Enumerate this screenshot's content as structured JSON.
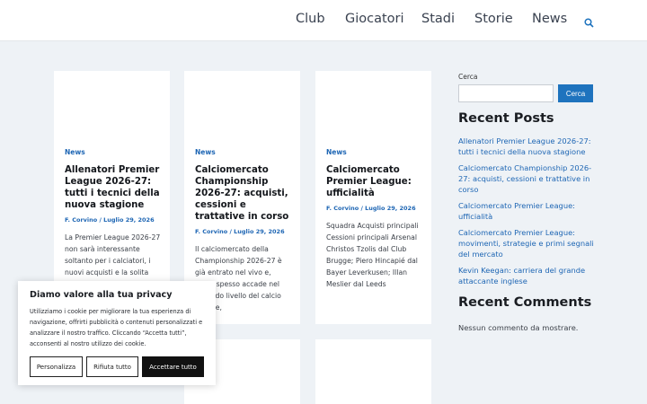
{
  "nav": {
    "items": [
      "Club",
      "Giocatori",
      "Stadi",
      "Storie",
      "News"
    ],
    "search_icon": "search-icon"
  },
  "posts": [
    {
      "category": "News",
      "title": "Allenatori Premier League 2026-27: tutti i tecnici della nuova stagione",
      "meta": "F. Corvino / Luglio 29, 2026",
      "excerpt": "La Premier League 2026-27 non sarà interessante soltanto per i calciatori, i nuovi acquisti e la solita"
    },
    {
      "category": "News",
      "title": "Calciomercato Championship 2026-27: acquisti, cessioni e trattative in corso",
      "meta": "F. Corvino / Luglio 29, 2026",
      "excerpt": "Il calciomercato della Championship 2026-27 è già entrato nel vivo e, come spesso accade nel secondo livello del calcio inglese,"
    },
    {
      "category": "News",
      "title": "Calciomercato Premier League: ufficialità",
      "meta": "F. Corvino / Luglio 29, 2026",
      "excerpt": "Squadra Acquisti principali Cessioni principali Arsenal Christos Tzolis dal Club Brugge; Piero Hincapié dal Bayer Leverkusen; Illan Meslier dal Leeds"
    }
  ],
  "sidebar": {
    "search_label": "Cerca",
    "search_button": "Cerca",
    "search_value": "",
    "recent_posts_heading": "Recent Posts",
    "recent_posts": [
      "Allenatori Premier League 2026-27: tutti i tecnici della nuova stagione",
      "Calciomercato Championship 2026-27: acquisti, cessioni e trattative in corso",
      "Calciomercato Premier League: ufficialità",
      "Calciomercato Premier League: movimenti, strategie e primi segnali del mercato",
      "Kevin Keegan: carriera del grande attaccante inglese"
    ],
    "recent_comments_heading": "Recent Comments",
    "no_comments": "Nessun commento da mostrare."
  },
  "cookie": {
    "title": "Diamo valore alla tua privacy",
    "text": "Utilizziamo i cookie per migliorare la tua esperienza di navigazione, offrirti pubblicità o contenuti personalizzati e analizzare il nostro traffico. Cliccando “Accetta tutti”, acconsenti al nostro utilizzo dei cookie.",
    "customize": "Personalizza",
    "reject": "Rifiuta tutto",
    "accept": "Accettare tutto"
  },
  "colors": {
    "accent": "#1e73be",
    "link": "#1e66b4",
    "background": "#eef2f6"
  }
}
